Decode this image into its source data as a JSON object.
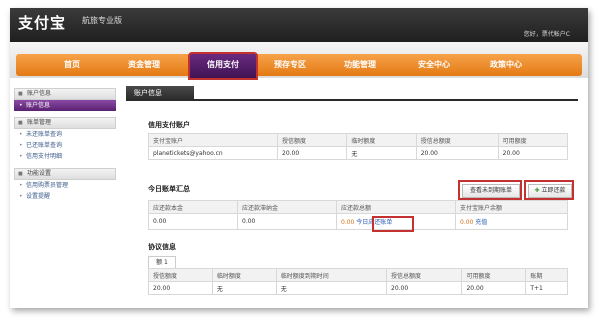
{
  "header": {
    "logo": "支付宝",
    "subtitle": "航旅专业版",
    "user": "您好，票代帐户C"
  },
  "nav": {
    "items": [
      "首页",
      "资金管理",
      "信用支付",
      "预存专区",
      "功能管理",
      "安全中心",
      "政策中心"
    ],
    "active": "信用支付"
  },
  "sidebar": {
    "groups": [
      {
        "title": "账户信息",
        "items": [
          "账户信息"
        ]
      },
      {
        "title": "账单管理",
        "items": [
          "未还账单查询",
          "已还账单查询",
          "信用支付明细"
        ]
      },
      {
        "title": "功能设置",
        "items": [
          "信用购票员管理",
          "设置提醒"
        ]
      }
    ],
    "active_item": "账户信息"
  },
  "content": {
    "tab": "账户信息",
    "credit_section": {
      "title": "信用支付账户",
      "headers": [
        "支付宝账户",
        "授信额度",
        "临时额度",
        "授信总额度",
        "可用额度"
      ],
      "row": [
        "planetickets@yahoo.cn",
        "20.00",
        "无",
        "20.00",
        "20.00"
      ]
    },
    "bill_section": {
      "title": "今日账单汇总",
      "btn_unpaid": "查看未到期账单",
      "btn_repay": "立即还款",
      "headers": [
        "应还款本金",
        "应还款滞纳金",
        "应还款总额",
        "支付宝账户余额"
      ],
      "row": {
        "principal": "0.00",
        "late_fee": "0.00",
        "total_amount": "0.00",
        "total_link": "今日应还账单",
        "balance": "0.00",
        "recharge": "充值"
      }
    },
    "agreement_section": {
      "title": "协议信息",
      "tab": "额 1",
      "headers": [
        "授信额度",
        "临时额度",
        "临时额度到期时间",
        "授信总额度",
        "可用额度",
        "账期"
      ],
      "row": [
        "20.00",
        "无",
        "无",
        "20.00",
        "20.00",
        "T+1"
      ]
    }
  }
}
